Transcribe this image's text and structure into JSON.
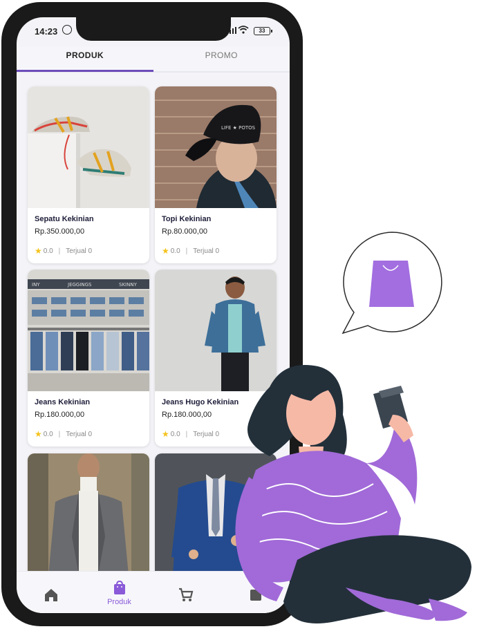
{
  "status_bar": {
    "time": "14:23",
    "battery": "33"
  },
  "tabs": [
    {
      "label": "PRODUK",
      "active": true
    },
    {
      "label": "PROMO",
      "active": false
    }
  ],
  "products": [
    {
      "name": "Sepatu Kekinian",
      "price": "Rp.350.000,00",
      "rating": "0.0",
      "sold": "Terjual 0"
    },
    {
      "name": "Topi Kekinian",
      "price": "Rp.80.000,00",
      "rating": "0.0",
      "sold": "Terjual 0"
    },
    {
      "name": "Jeans Kekinian",
      "price": "Rp.180.000,00",
      "rating": "0.0",
      "sold": "Terjual 0"
    },
    {
      "name": "Jeans Hugo Kekinian",
      "price": "Rp.180.000,00",
      "rating": "0.0",
      "sold": "Terjual 0"
    },
    {
      "name": "",
      "price": "",
      "rating": "",
      "sold": ""
    },
    {
      "name": "",
      "price": "",
      "rating": "",
      "sold": ""
    }
  ],
  "bottom_nav": [
    {
      "icon": "home-icon",
      "label": ""
    },
    {
      "icon": "shopping-bag-icon",
      "label": "Produk",
      "active": true
    },
    {
      "icon": "cart-icon",
      "label": ""
    },
    {
      "icon": "profile-icon",
      "label": ""
    }
  ],
  "colors": {
    "accent": "#8a5ad8",
    "tab_indicator": "#6c4dba",
    "star": "#f4c21b",
    "phone_frame": "#1a1a1a"
  }
}
